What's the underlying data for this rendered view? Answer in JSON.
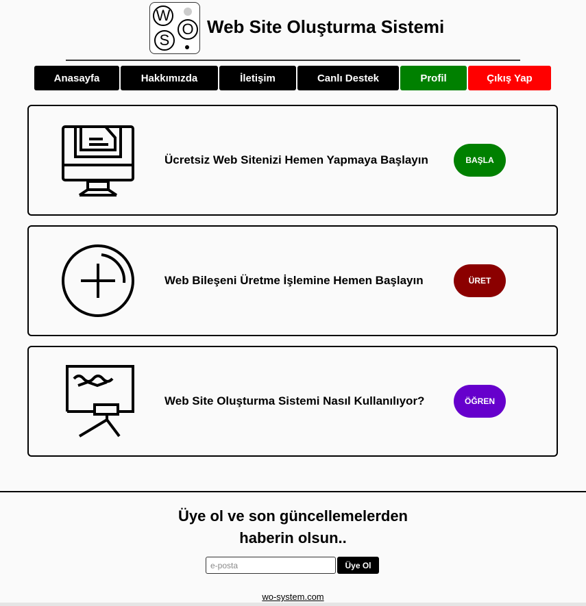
{
  "header": {
    "title": "Web Site Oluşturma Sistemi",
    "logo": {
      "letters": [
        "W",
        "S",
        "O"
      ]
    }
  },
  "nav": {
    "items": [
      {
        "label": "Anasayfa",
        "color": "#000000"
      },
      {
        "label": "Hakkımızda",
        "color": "#000000"
      },
      {
        "label": "İletişim",
        "color": "#000000"
      },
      {
        "label": "Canlı Destek",
        "color": "#000000"
      },
      {
        "label": "Profil",
        "color": "#008000"
      },
      {
        "label": "Çıkış Yap",
        "color": "#ff0000"
      }
    ]
  },
  "cards": [
    {
      "icon": "monitor-document-icon",
      "text": "Ücretsiz Web Sitenizi Hemen Yapmaya Başlayın",
      "button": "BAŞLA",
      "button_color": "#008000"
    },
    {
      "icon": "circle-plus-icon",
      "text": "Web Bileşeni Üretme İşlemine Hemen Başlayın",
      "button": "ÜRET",
      "button_color": "#8b0000"
    },
    {
      "icon": "presentation-board-icon",
      "text": "Web Site Oluşturma Sistemi Nasıl Kullanılıyor?",
      "button": "ÖĞREN",
      "button_color": "#6600cc"
    }
  ],
  "newsletter": {
    "line1": "Üye ol ve son güncellemelerden",
    "line2": "haberin olsun..",
    "placeholder": "e-posta",
    "button": "Üye Ol"
  },
  "footer": {
    "link": "wo-system.com"
  }
}
